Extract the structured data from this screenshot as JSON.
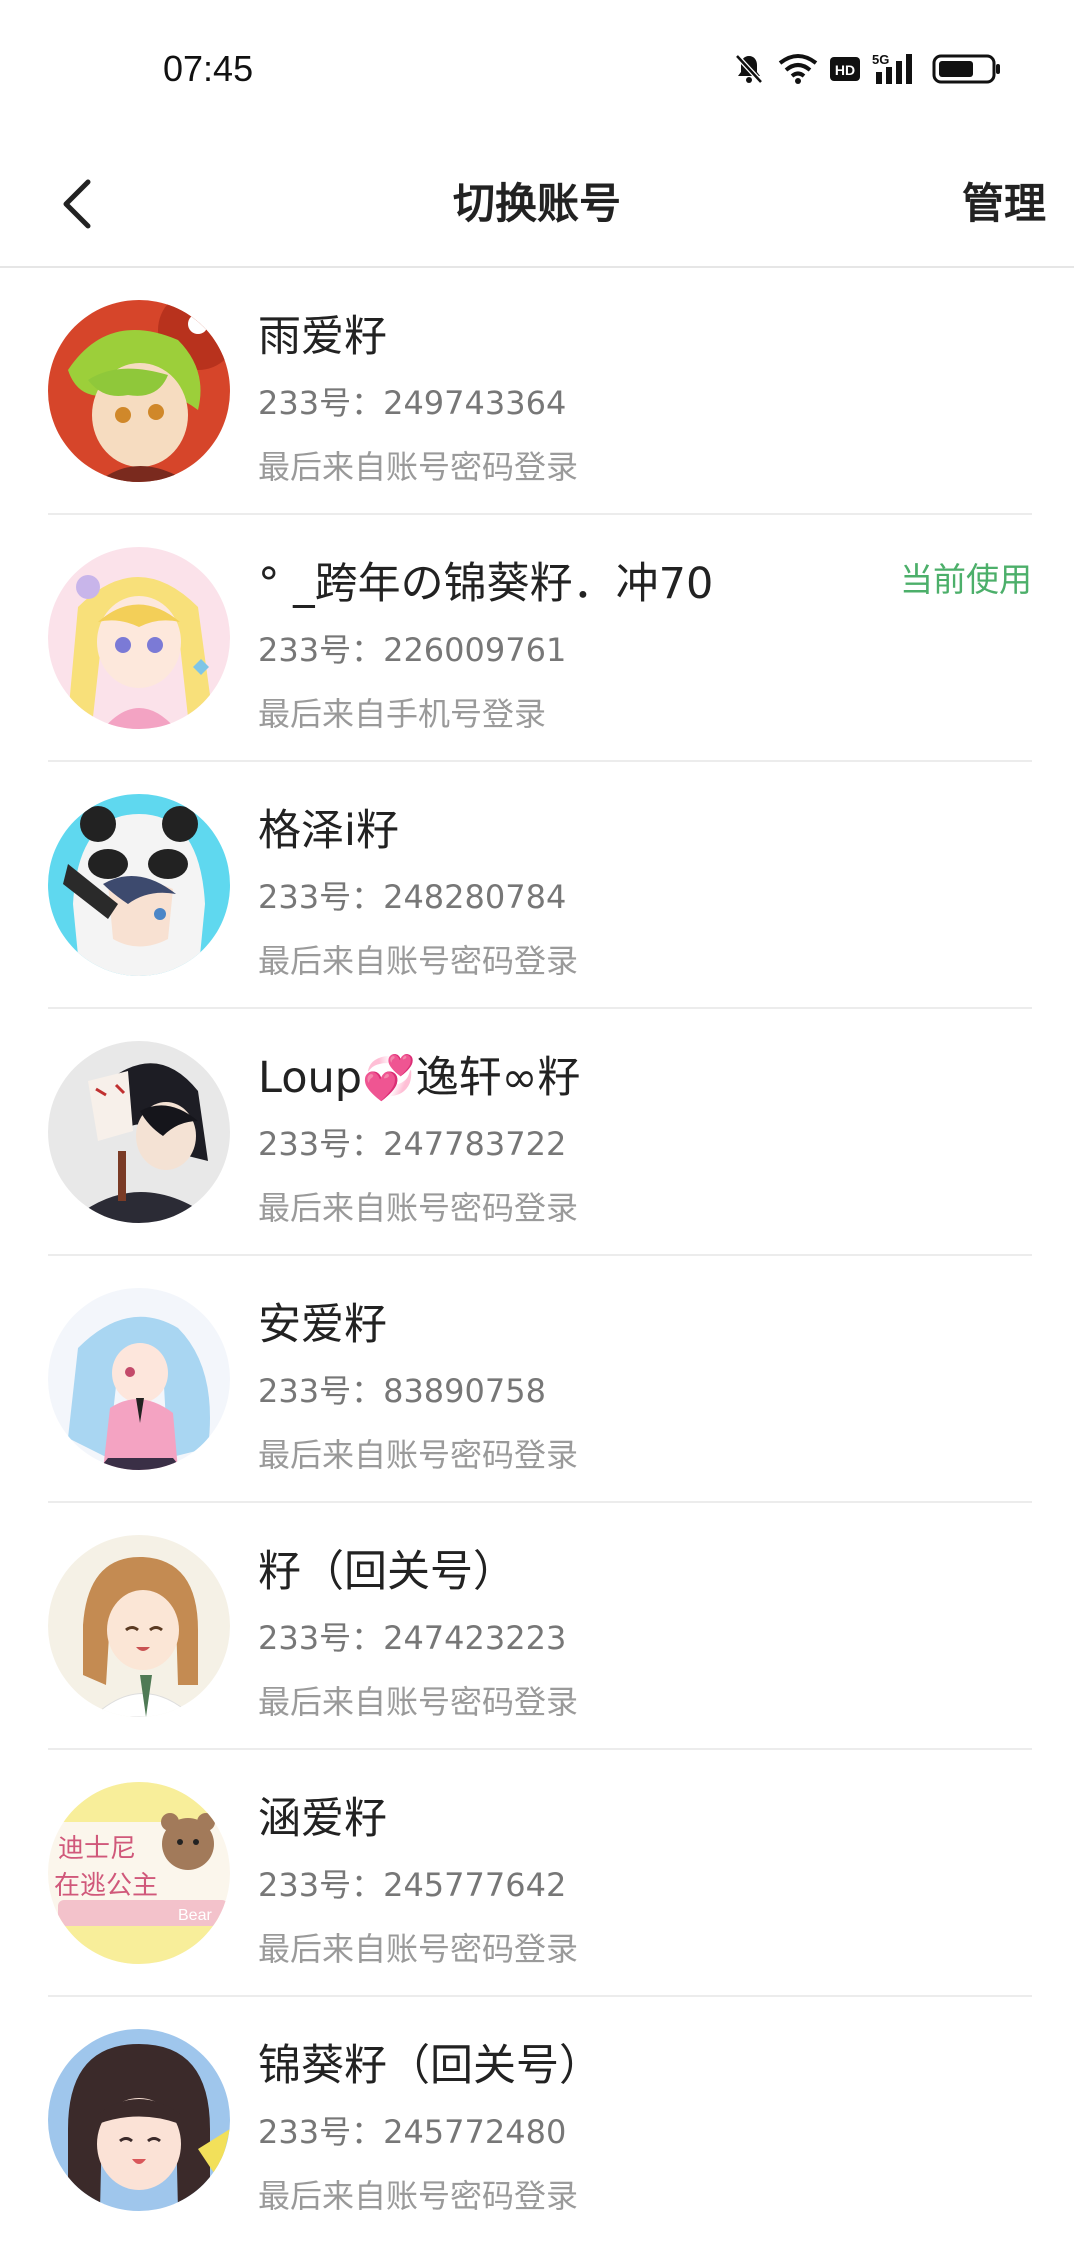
{
  "status_bar": {
    "time": "07:45",
    "icons": [
      "bell-muted-icon",
      "wifi-icon",
      "hd-icon",
      "5g-signal-icon",
      "battery-icon"
    ],
    "hd_label": "HD",
    "network_label": "5G"
  },
  "nav": {
    "back_icon": "chevron-left-icon",
    "title": "切换账号",
    "manage_label": "管理"
  },
  "accent_color": "#4caf6a",
  "accounts": [
    {
      "name": "雨爱籽",
      "id_text": "233号：249743364",
      "login_text": "最后来自账号密码登录",
      "current": ""
    },
    {
      "name": "° _跨年の锦葵籽．冲70",
      "id_text": "233号：226009761",
      "login_text": "最后来自手机号登录",
      "current": "当前使用"
    },
    {
      "name": "格泽i籽",
      "id_text": "233号：248280784",
      "login_text": "最后来自账号密码登录",
      "current": ""
    },
    {
      "name": "Loup💞逸轩∞籽",
      "id_text": "233号：247783722",
      "login_text": "最后来自账号密码登录",
      "current": ""
    },
    {
      "name": "安爱籽",
      "id_text": "233号：83890758",
      "login_text": "最后来自账号密码登录",
      "current": ""
    },
    {
      "name": "籽（回关号）",
      "id_text": "233号：247423223",
      "login_text": "最后来自账号密码登录",
      "current": ""
    },
    {
      "name": "涵爱籽",
      "id_text": "233号：245777642",
      "login_text": "最后来自账号密码登录",
      "current": ""
    },
    {
      "name": "锦葵籽（回关号）",
      "id_text": "233号：245772480",
      "login_text": "最后来自账号密码登录",
      "current": ""
    }
  ],
  "avatar_texts": {
    "account7_line1": "迪士尼",
    "account7_line2": "在逃公主",
    "account7_tag": "Bear"
  }
}
